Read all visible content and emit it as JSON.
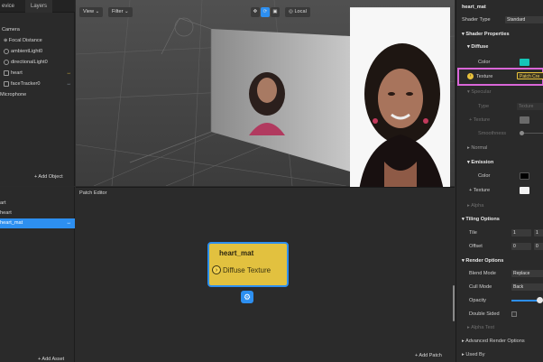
{
  "layers_panel": {
    "tabs": [
      "evice",
      "Layers"
    ],
    "items": [
      {
        "label": "Camera",
        "badge": ""
      },
      {
        "label": "Focal Distance",
        "badge": ""
      },
      {
        "label": "ambientLight0",
        "badge": ""
      },
      {
        "label": "directionalLight0",
        "badge": ""
      },
      {
        "label": "heart",
        "badge": "↔"
      },
      {
        "label": "faceTracker0",
        "badge": "↔"
      },
      {
        "label": "Microphone",
        "badge": ""
      }
    ],
    "add_label": "+ Add Object"
  },
  "assets_panel": {
    "items": [
      {
        "label": "art",
        "selected": false
      },
      {
        "label": "heart",
        "selected": false
      },
      {
        "label": "heart_mat",
        "selected": true,
        "badge": "↔"
      }
    ],
    "add_label": "+ Add Asset"
  },
  "viewport": {
    "view_label": "View ⌄",
    "filter_label": "Filter ⌄",
    "local_label": "Local"
  },
  "patch_editor": {
    "title": "Patch Editor",
    "node_title": "heart_mat",
    "node_port": "Diffuse Texture",
    "add_label": "+ Add Patch"
  },
  "inspector": {
    "title": "heart_mat",
    "shader_type_label": "Shader Type",
    "shader_type_value": "Standard",
    "shader_props_label": "Shader Properties",
    "diffuse_label": "Diffuse",
    "color_label": "Color",
    "texture_label": "Texture",
    "texture_value": "Patch Cre",
    "specular_label": "Specular",
    "type_label": "Type",
    "type_value": "Texture",
    "spec_texture_label": "Texture",
    "smoothness_label": "Smoothness",
    "normal_label": "Normal",
    "emission_label": "Emission",
    "emission_color_label": "Color",
    "emission_texture_label": "Texture",
    "alpha_label": "Alpha",
    "tiling_label": "Tiling Options",
    "tile_label": "Tile",
    "tile_x": "1",
    "tile_y": "1",
    "offset_label": "Offset",
    "offset_x": "0",
    "offset_y": "0",
    "render_label": "Render Options",
    "blend_label": "Blend Mode",
    "blend_value": "Replace",
    "cull_label": "Cull Mode",
    "cull_value": "Back",
    "opacity_label": "Opacity",
    "opacity_level": 0.9,
    "double_sided_label": "Double Sided",
    "alpha_test_label": "Alpha Test",
    "advanced_label": "Advanced Render Options",
    "used_by_label": "Used By"
  },
  "colors": {
    "accent": "#2d8ff0",
    "node_yellow": "#e2c13f",
    "highlight": "#d966d8",
    "diffuse_color": "#14c6b8"
  }
}
